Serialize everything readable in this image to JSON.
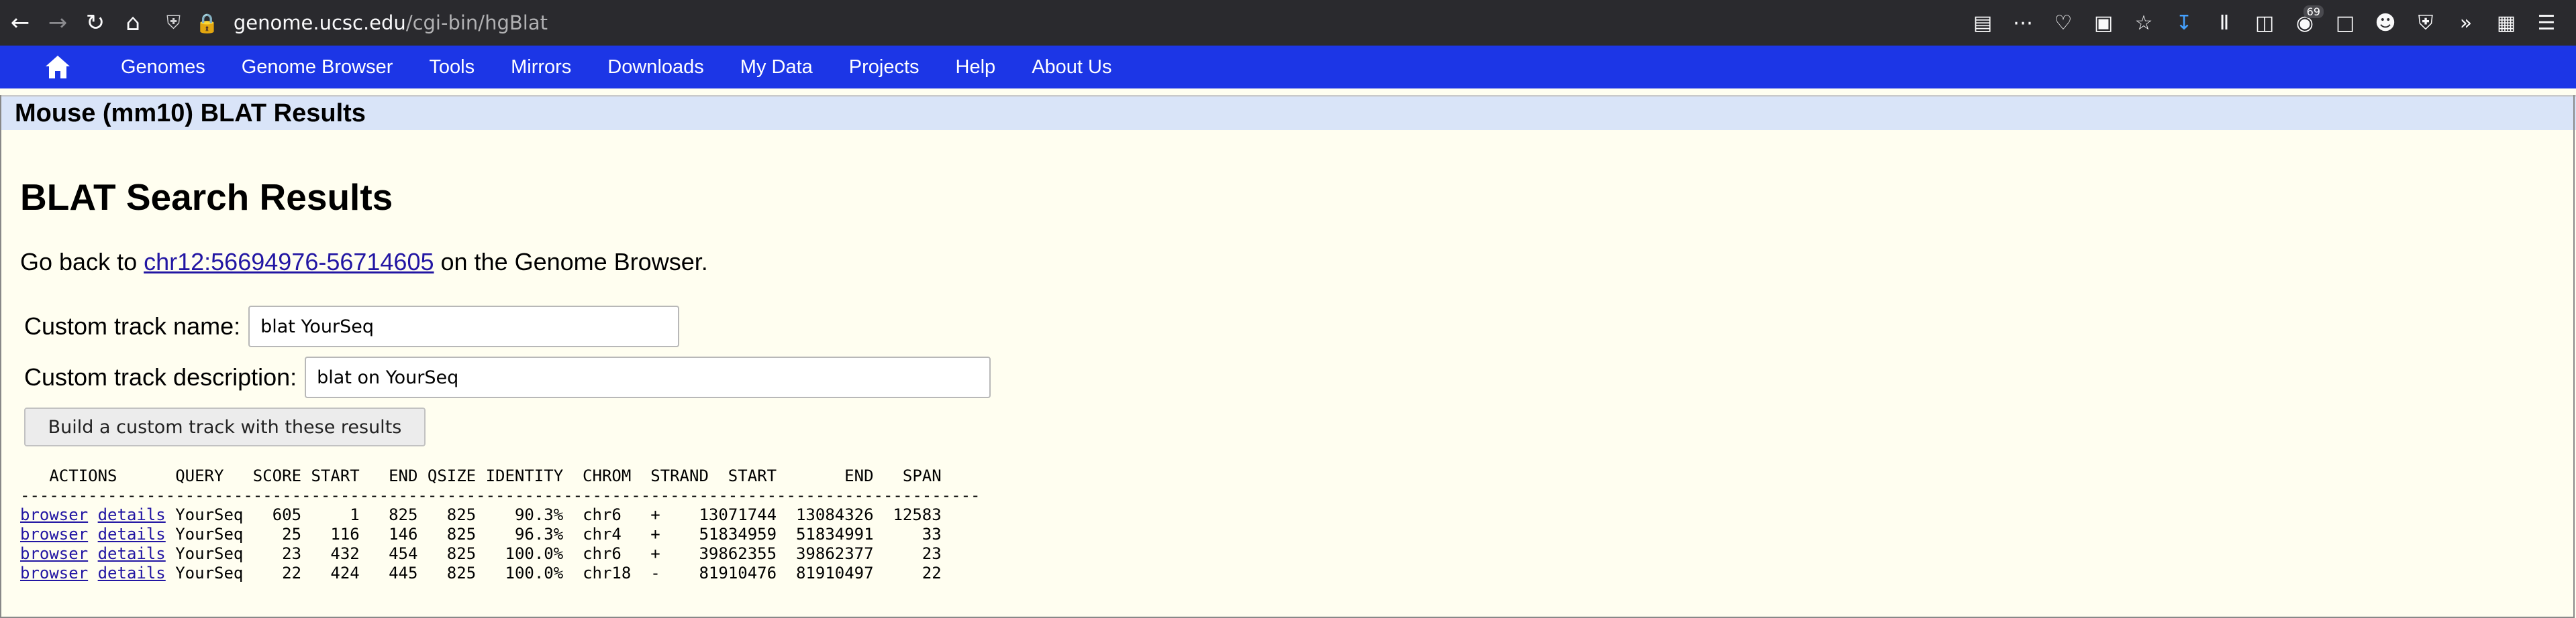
{
  "browser": {
    "url_host": "genome.ucsc.edu",
    "url_path": "/cgi-bin/hgBlat",
    "tab_count_badge": "69"
  },
  "nav": {
    "items": [
      "Genomes",
      "Genome Browser",
      "Tools",
      "Mirrors",
      "Downloads",
      "My Data",
      "Projects",
      "Help",
      "About Us"
    ]
  },
  "page": {
    "section_title": "Mouse (mm10) BLAT Results",
    "heading": "BLAT Search Results",
    "goback_prefix": "Go back to ",
    "goback_link": "chr12:56694976-56714605",
    "goback_suffix": " on the Genome Browser.",
    "track_name_label": "Custom track name:",
    "track_name_value": "blat YourSeq",
    "track_desc_label": "Custom track description:",
    "track_desc_value": "blat on YourSeq",
    "build_button": "Build a custom track with these results"
  },
  "results": {
    "header": "   ACTIONS      QUERY   SCORE START   END QSIZE IDENTITY  CHROM  STRAND  START       END   SPAN",
    "divider": "---------------------------------------------------------------------------------------------------",
    "action_browser": "browser",
    "action_details": "details",
    "rows": [
      " YourSeq   605     1   825   825    90.3%  chr6   +    13071744  13084326  12583",
      " YourSeq    25   116   146   825    96.3%  chr4   +    51834959  51834991     33",
      " YourSeq    23   432   454   825   100.0%  chr6   +    39862355  39862377     23",
      " YourSeq    22   424   445   825   100.0%  chr18  -    81910476  81910497     22"
    ]
  }
}
